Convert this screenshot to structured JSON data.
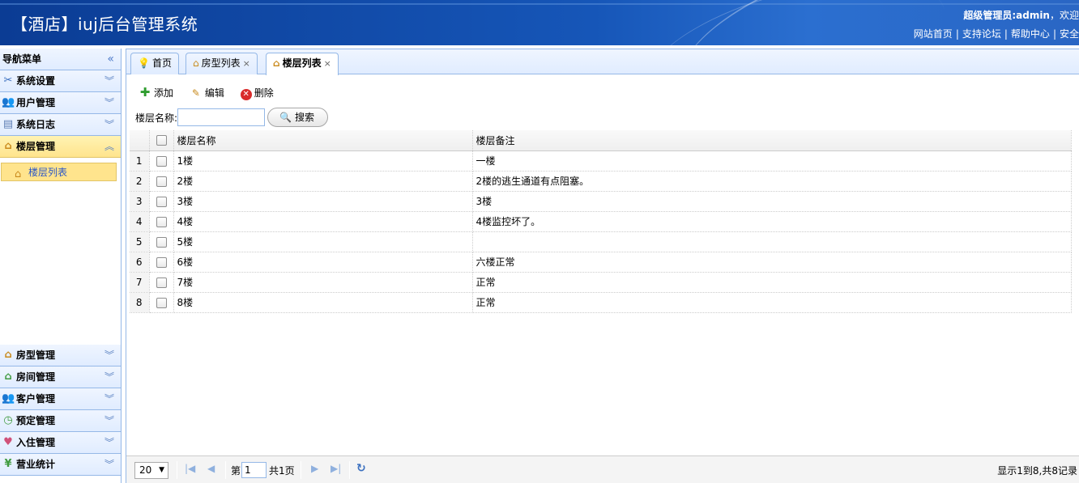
{
  "header": {
    "title": "【酒店】iuj后台管理系统",
    "welcome_bold": "超级管理员:admin",
    "welcome_rest": "，欢迎",
    "links": [
      "网站首页",
      "支持论坛",
      "帮助中心",
      "安全"
    ]
  },
  "sidebar": {
    "title": "导航菜单",
    "collapse_icon": "«",
    "top_items": [
      {
        "label": "系统设置",
        "icon": "tools-icon"
      },
      {
        "label": "用户管理",
        "icon": "users-icon"
      },
      {
        "label": "系统日志",
        "icon": "log-icon"
      }
    ],
    "active_item": {
      "label": "楼层管理",
      "icon": "house-icon"
    },
    "active_sub": {
      "label": "楼层列表"
    },
    "bottom_items": [
      {
        "label": "房型管理",
        "icon": "house-icon"
      },
      {
        "label": "房间管理",
        "icon": "house-icon"
      },
      {
        "label": "客户管理",
        "icon": "customers-icon"
      },
      {
        "label": "预定管理",
        "icon": "clock-icon"
      },
      {
        "label": "入住管理",
        "icon": "heart-icon"
      },
      {
        "label": "营业统计",
        "icon": "yen-icon"
      }
    ]
  },
  "tabs": [
    {
      "label": "首页"
    },
    {
      "label": "房型列表"
    },
    {
      "label": "楼层列表"
    }
  ],
  "toolbar": {
    "add": "添加",
    "edit": "编辑",
    "delete": "删除"
  },
  "search": {
    "label": "楼层名称:",
    "value": "",
    "button": "搜索"
  },
  "grid": {
    "columns": [
      "楼层名称",
      "楼层备注"
    ],
    "rows": [
      {
        "n": "1",
        "name": "1楼",
        "note": "一楼"
      },
      {
        "n": "2",
        "name": "2楼",
        "note": "2楼的逃生通道有点阻塞。"
      },
      {
        "n": "3",
        "name": "3楼",
        "note": "3楼"
      },
      {
        "n": "4",
        "name": "4楼",
        "note": "4楼监控坏了。"
      },
      {
        "n": "5",
        "name": "5楼",
        "note": ""
      },
      {
        "n": "6",
        "name": "6楼",
        "note": "六楼正常"
      },
      {
        "n": "7",
        "name": "7楼",
        "note": "正常"
      },
      {
        "n": "8",
        "name": "8楼",
        "note": "正常"
      }
    ]
  },
  "pager": {
    "page_size": "20",
    "page_prefix": "第",
    "page_value": "1",
    "page_total": "共1页",
    "info": "显示1到8,共8记录"
  }
}
